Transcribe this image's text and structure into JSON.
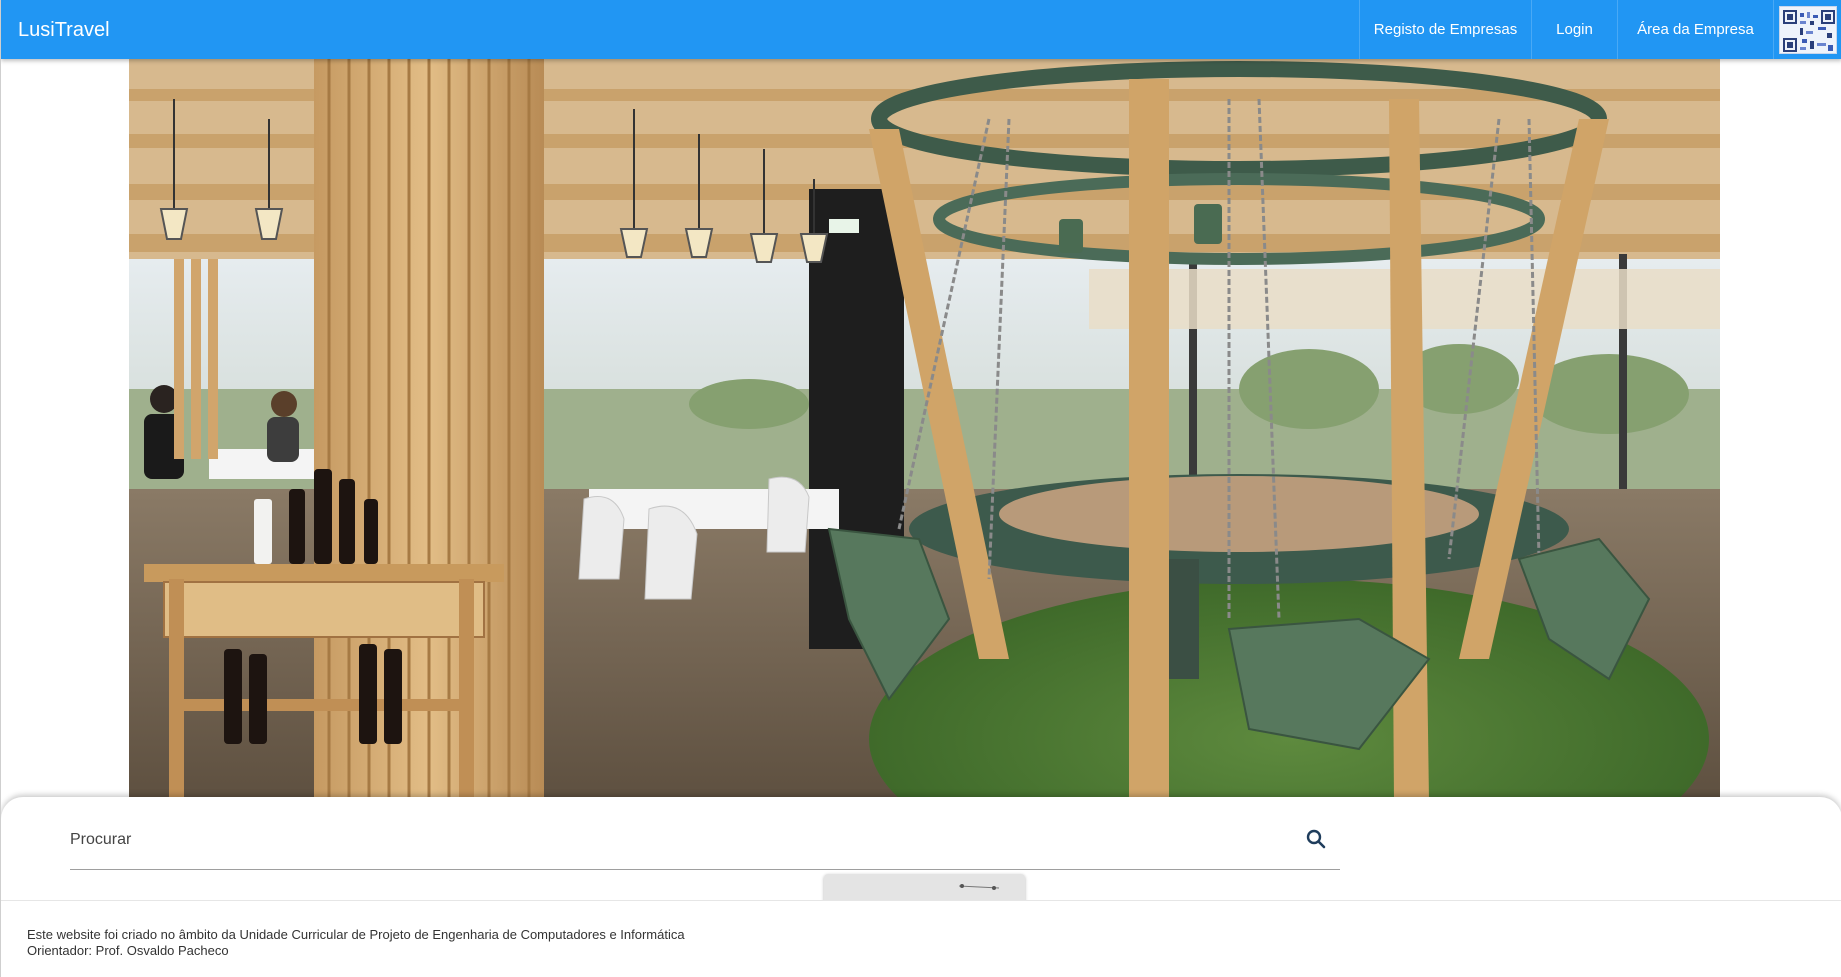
{
  "app": {
    "title": "LusiTravel"
  },
  "nav": {
    "items": [
      {
        "label": "Registo de Empresas"
      },
      {
        "label": "Login"
      },
      {
        "label": "Área da Empresa"
      }
    ],
    "avatar_icon": "qr-code-avatar-icon"
  },
  "hero": {
    "subject": "restaurant interior photo"
  },
  "search": {
    "placeholder": "Procurar",
    "value": "",
    "icon": "search-icon"
  },
  "footer": {
    "line1": "Este website foi criado no âmbito da Unidade Curricular de Projeto de Engenharia de Computadores e Informática",
    "line2": "Orientador: Prof. Osvaldo Pacheco"
  },
  "colors": {
    "appbar": "#2196f3",
    "text_dark": "#333333"
  }
}
